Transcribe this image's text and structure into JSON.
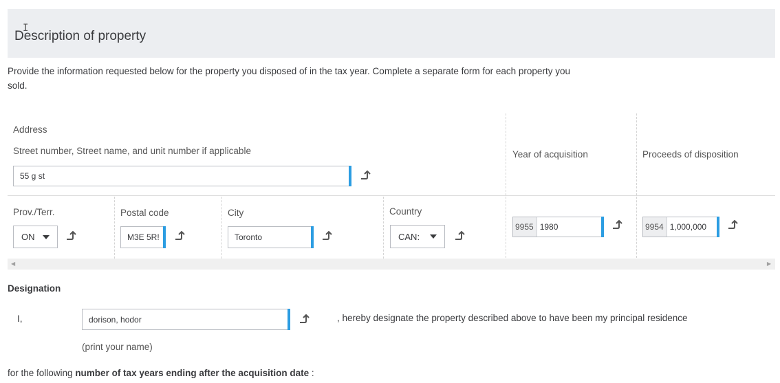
{
  "section": {
    "title": "Description of property"
  },
  "intro": "Provide the information requested below for the property you disposed of in the tax year. Complete a separate form for each property you sold.",
  "address": {
    "heading": "Address",
    "street_label": "Street number, Street name, and unit number if applicable",
    "street_value": "55 g st"
  },
  "acquisition": {
    "label": "Year of acquisition",
    "prefix": "9955",
    "value": "1980"
  },
  "proceeds": {
    "label": "Proceeds of disposition",
    "prefix": "9954",
    "value": "1,000,000"
  },
  "province": {
    "label": "Prov./Terr.",
    "value": "ON"
  },
  "postal": {
    "label": "Postal code",
    "value": "M3E 5R!"
  },
  "city": {
    "label": "City",
    "value": "Toronto"
  },
  "country": {
    "label": "Country",
    "value": "CAN:"
  },
  "designation": {
    "heading": "Designation",
    "prefix": "I,",
    "name_value": "dorison, hodor",
    "statement": ", hereby designate the property described above to have been my principal residence",
    "hint": "(print your name)"
  },
  "footer": {
    "lead": "for the following ",
    "bold": "number of tax years ending after the acquisition date",
    "tail": " :"
  },
  "icons": {
    "jump": "jump-to-slip-icon",
    "scroll_left": "scroll-left-icon",
    "scroll_right": "scroll-right-icon"
  },
  "colors": {
    "accent": "#2c9de2",
    "header_bg": "#eceef1"
  }
}
